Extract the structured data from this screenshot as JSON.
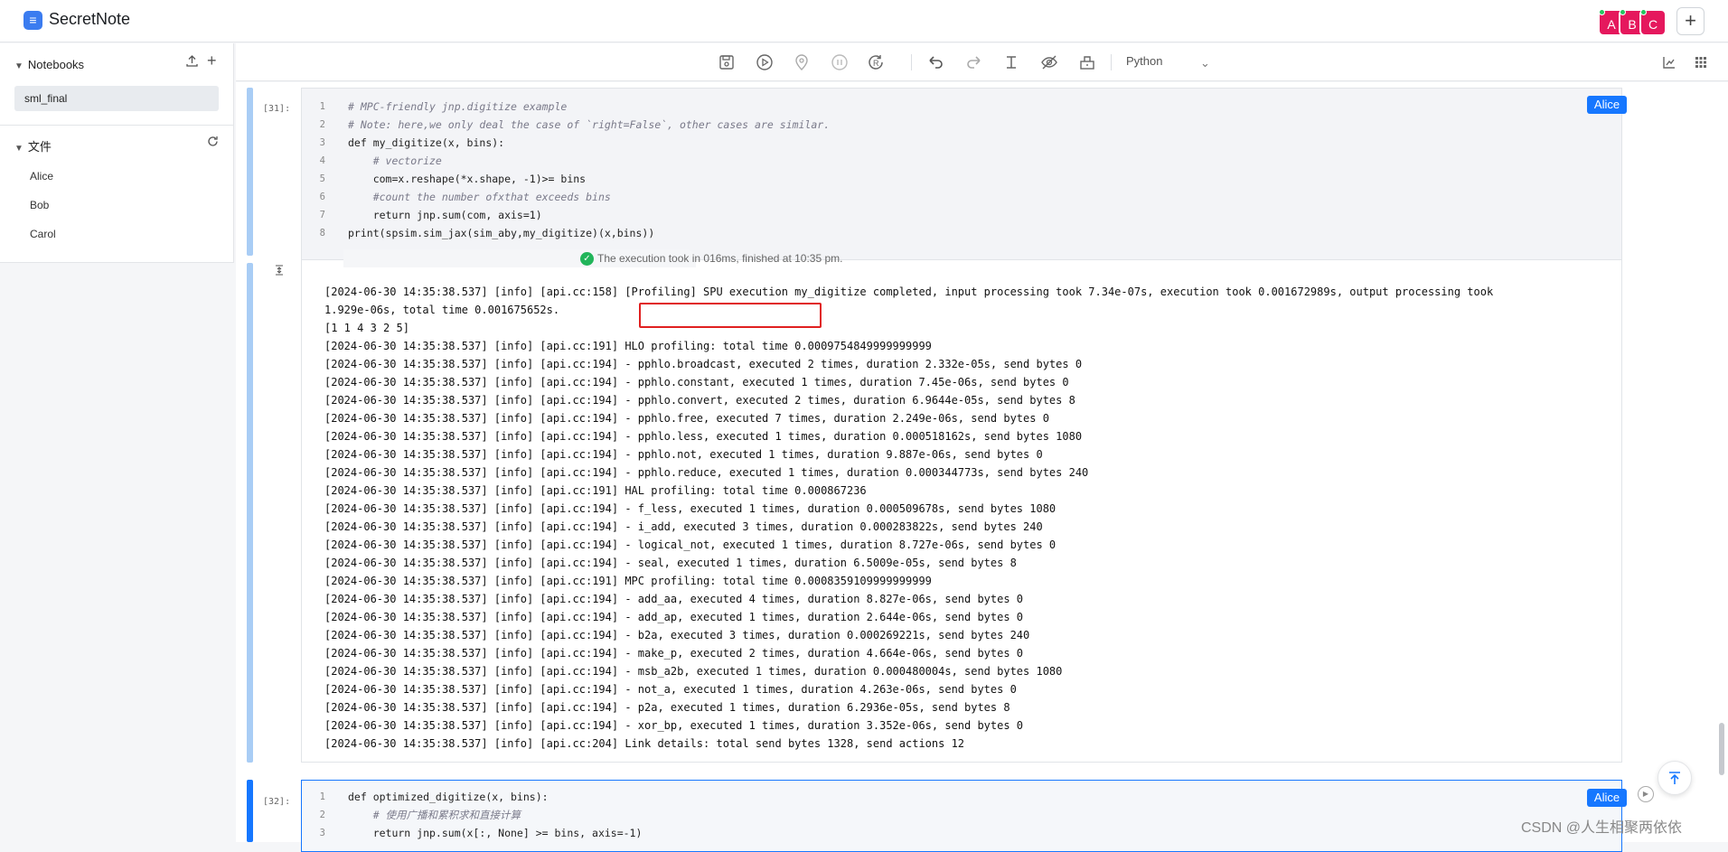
{
  "app": {
    "logo": "≡",
    "title": "SecretNote"
  },
  "header": {
    "avatars": [
      {
        "label": "A"
      },
      {
        "label": "B"
      },
      {
        "label": "C"
      }
    ],
    "add_label": "+"
  },
  "sidebar": {
    "notebooks_label": "Notebooks",
    "notebooks": [
      "sml_final"
    ],
    "files_label": "文件",
    "files": [
      "Alice",
      "Bob",
      "Carol"
    ]
  },
  "toolbar": {
    "language": "Python",
    "icons": [
      "save-icon",
      "run-icon",
      "location-icon",
      "pause-icon",
      "restart-icon",
      "undo-icon",
      "redo-icon",
      "text-cursor-icon",
      "hide-icon",
      "tool-icon",
      "chart-icon",
      "grid-icon"
    ]
  },
  "cells": [
    {
      "number": "[31]:",
      "user": "Alice",
      "lines": [
        {
          "no": "1",
          "text": "# MPC-friendly jnp.digitize example"
        },
        {
          "no": "2",
          "text": "# Note: here,we only deal the case of `right=False`, other cases are similar."
        },
        {
          "no": "3",
          "text": "def my_digitize(x, bins):"
        },
        {
          "no": "4",
          "text": "    # vectorize"
        },
        {
          "no": "5",
          "text": "    com=x.reshape(*x.shape, -1)>= bins"
        },
        {
          "no": "6",
          "text": "    #count the number ofxthat exceeds bins"
        },
        {
          "no": "7",
          "text": "    return jnp.sum(com, axis=1)"
        },
        {
          "no": "8",
          "text": "print(spsim.sim_jax(sim_aby,my_digitize)(x,bins))"
        }
      ],
      "exec_note": "The execution took in 016ms, finished at 10:35 pm.",
      "output": [
        "[2024-06-30 14:35:38.537] [info] [api.cc:158] [Profiling] SPU execution my_digitize completed, input processing took 7.34e-07s, execution took 0.001672989s, output processing took",
        "1.929e-06s, total time 0.001675652s.",
        "[1 1 4 3 2 5]",
        "[2024-06-30 14:35:38.537] [info] [api.cc:191] HLO profiling: total time 0.0009754849999999999",
        "[2024-06-30 14:35:38.537] [info] [api.cc:194] - pphlo.broadcast, executed 2 times, duration 2.332e-05s, send bytes 0",
        "[2024-06-30 14:35:38.537] [info] [api.cc:194] - pphlo.constant, executed 1 times, duration 7.45e-06s, send bytes 0",
        "[2024-06-30 14:35:38.537] [info] [api.cc:194] - pphlo.convert, executed 2 times, duration 6.9644e-05s, send bytes 8",
        "[2024-06-30 14:35:38.537] [info] [api.cc:194] - pphlo.free, executed 7 times, duration 2.249e-06s, send bytes 0",
        "[2024-06-30 14:35:38.537] [info] [api.cc:194] - pphlo.less, executed 1 times, duration 0.000518162s, send bytes 1080",
        "[2024-06-30 14:35:38.537] [info] [api.cc:194] - pphlo.not, executed 1 times, duration 9.887e-06s, send bytes 0",
        "[2024-06-30 14:35:38.537] [info] [api.cc:194] - pphlo.reduce, executed 1 times, duration 0.000344773s, send bytes 240",
        "[2024-06-30 14:35:38.537] [info] [api.cc:191] HAL profiling: total time 0.000867236",
        "[2024-06-30 14:35:38.537] [info] [api.cc:194] - f_less, executed 1 times, duration 0.000509678s, send bytes 1080",
        "[2024-06-30 14:35:38.537] [info] [api.cc:194] - i_add, executed 3 times, duration 0.000283822s, send bytes 240",
        "[2024-06-30 14:35:38.537] [info] [api.cc:194] - logical_not, executed 1 times, duration 8.727e-06s, send bytes 0",
        "[2024-06-30 14:35:38.537] [info] [api.cc:194] - seal, executed 1 times, duration 6.5009e-05s, send bytes 8",
        "[2024-06-30 14:35:38.537] [info] [api.cc:191] MPC profiling: total time 0.0008359109999999999",
        "[2024-06-30 14:35:38.537] [info] [api.cc:194] - add_aa, executed 4 times, duration 8.827e-06s, send bytes 0",
        "[2024-06-30 14:35:38.537] [info] [api.cc:194] - add_ap, executed 1 times, duration 2.644e-06s, send bytes 0",
        "[2024-06-30 14:35:38.537] [info] [api.cc:194] - b2a, executed 3 times, duration 0.000269221s, send bytes 240",
        "[2024-06-30 14:35:38.537] [info] [api.cc:194] - make_p, executed 2 times, duration 4.664e-06s, send bytes 0",
        "[2024-06-30 14:35:38.537] [info] [api.cc:194] - msb_a2b, executed 1 times, duration 0.000480004s, send bytes 1080",
        "[2024-06-30 14:35:38.537] [info] [api.cc:194] - not_a, executed 1 times, duration 4.263e-06s, send bytes 0",
        "[2024-06-30 14:35:38.537] [info] [api.cc:194] - p2a, executed 1 times, duration 6.2936e-05s, send bytes 8",
        "[2024-06-30 14:35:38.537] [info] [api.cc:194] - xor_bp, executed 1 times, duration 3.352e-06s, send bytes 0",
        "[2024-06-30 14:35:38.537] [info] [api.cc:204] Link details: total send bytes 1328, send actions 12"
      ]
    },
    {
      "number": "[32]:",
      "user": "Alice",
      "lines": [
        {
          "no": "1",
          "text": "def optimized_digitize(x, bins):"
        },
        {
          "no": "2",
          "text": "    # 使用广播和累积求和直接计算"
        },
        {
          "no": "3",
          "text": "    return jnp.sum(x[:, None] >= bins, axis=-1)"
        }
      ]
    }
  ],
  "watermark": "CSDN @人生相聚两依依",
  "colors": {
    "accent": "#1677ff",
    "avatar": "#e5185d",
    "highlight_box": "#e02020",
    "success": "#22b55a"
  }
}
